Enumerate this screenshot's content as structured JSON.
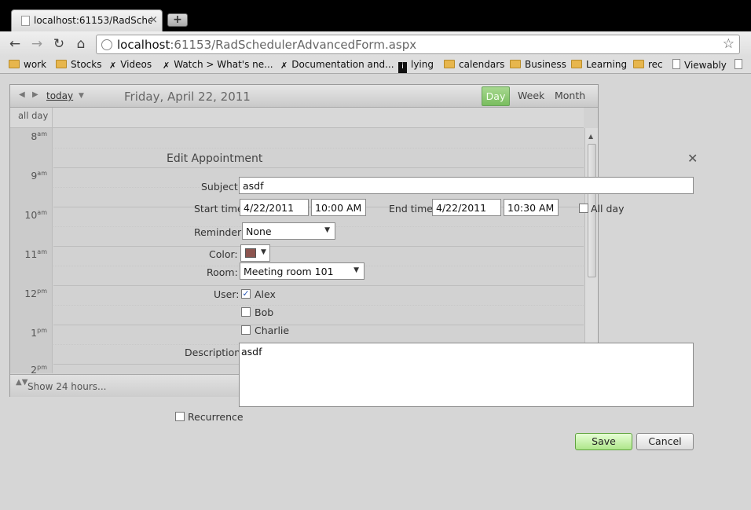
{
  "browser": {
    "tab_title": "localhost:61153/RadSche...",
    "tab_close": "×",
    "new_tab": "+",
    "url_host": "localhost",
    "url_rest": ":61153/RadSchedulerAdvancedForm.aspx",
    "nav": {
      "back": "←",
      "forward": "→",
      "reload": "↻",
      "home": "⌂",
      "star": "☆"
    },
    "bookmarks": [
      "work",
      "Stocks",
      "Videos",
      "Watch > What's ne...",
      "Documentation and...",
      "lying",
      "calendars",
      "Business",
      "Learning",
      "rec",
      "Viewably"
    ]
  },
  "scheduler": {
    "nav_prev": "◀",
    "nav_next": "▶",
    "today": "today",
    "today_drop": "▼",
    "date": "Friday, April 22, 2011",
    "views": [
      "Day",
      "Week",
      "Month"
    ],
    "active_view": "Day",
    "all_day": "all day",
    "hours": [
      {
        "h": "8",
        "m": "am"
      },
      {
        "h": "9",
        "m": "am"
      },
      {
        "h": "10",
        "m": "am"
      },
      {
        "h": "11",
        "m": "am"
      },
      {
        "h": "12",
        "m": "pm"
      },
      {
        "h": "1",
        "m": "pm"
      },
      {
        "h": "2",
        "m": "pm"
      }
    ],
    "footer_icon": "▲▼",
    "footer": "Show 24 hours..."
  },
  "form": {
    "title": "Edit Appointment",
    "close": "✕",
    "subject_label": "Subject:",
    "subject": "asdf",
    "start_label": "Start time",
    "start_date": "4/22/2011",
    "start_time": "10:00 AM",
    "end_label": "End time",
    "end_date": "4/22/2011",
    "end_time": "10:30 AM",
    "allday_label": "All day",
    "reminder_label": "Reminder",
    "reminder": "None",
    "color_label": "Color:",
    "color": "#8c544f",
    "room_label": "Room:",
    "room": "Meeting room 101",
    "user_label": "User:",
    "users": [
      {
        "name": "Alex",
        "checked": true
      },
      {
        "name": "Bob",
        "checked": false
      },
      {
        "name": "Charlie",
        "checked": false
      }
    ],
    "description_label": "Description:",
    "description": "asdf",
    "recurrence_label": "Recurrence",
    "save": "Save",
    "cancel": "Cancel",
    "caret": "▼",
    "check_mark": "✓"
  }
}
